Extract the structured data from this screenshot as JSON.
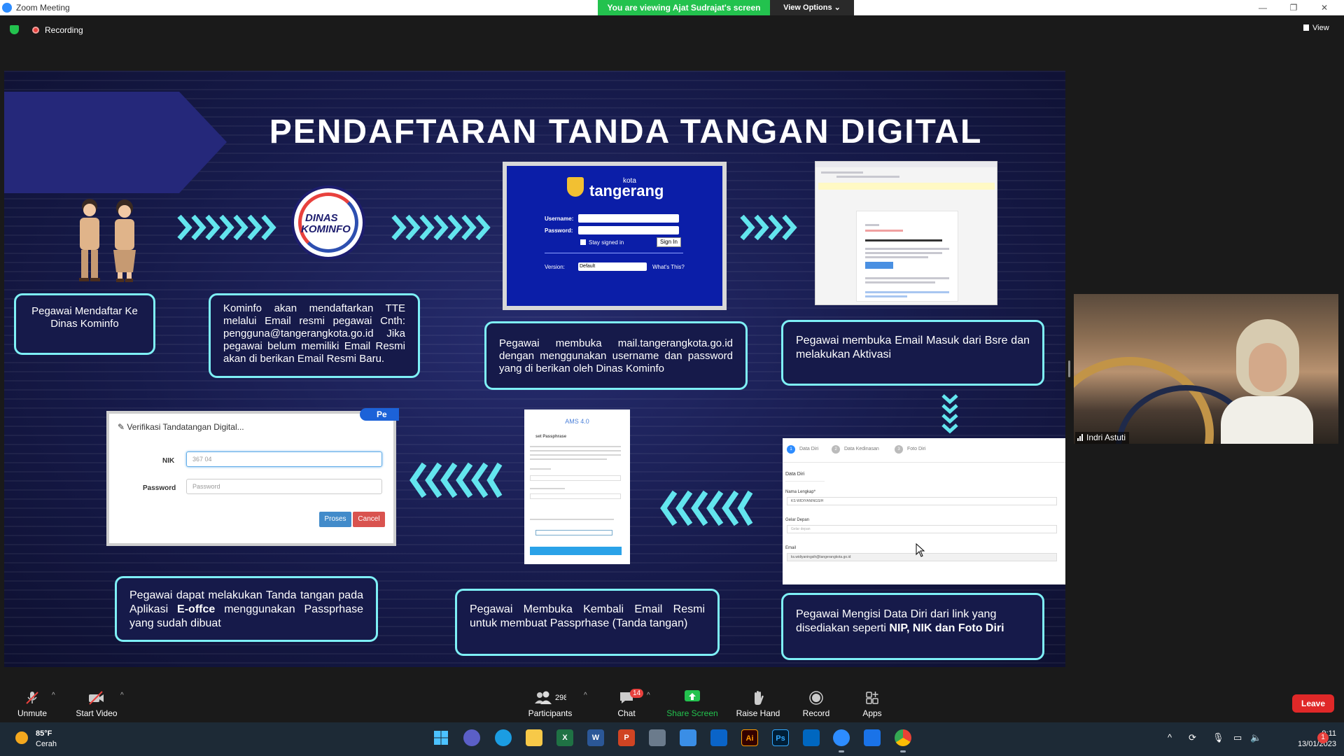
{
  "window": {
    "title": "Zoom Meeting",
    "viewing_banner": "You are viewing Ajat Sudrajat's screen",
    "view_options": "View Options",
    "minimize": "—",
    "maximize": "❐",
    "close": "✕"
  },
  "topbar": {
    "recording": "Recording",
    "view": "View"
  },
  "slide": {
    "title": "PENDAFTARAN TANDA TANGAN DIGITAL",
    "kominfo_logo_line1": "DINAS",
    "kominfo_logo_line2": "KOMINFO",
    "steps": [
      "Pegawai Mendaftar Ke Dinas Kominfo",
      "Kominfo akan mendaftarkan TTE melalui Email resmi pegawai Cnth: pengguna@tangerangkota.go.id Jika pegawai belum memiliki Email Resmi akan di berikan Email Resmi Baru.",
      "Pegawai membuka mail.tangerangkota.go.id dengan menggunakan username dan password yang di berikan oleh Dinas Kominfo",
      "Pegawai membuka Email Masuk dari Bsre dan melakukan Aktivasi",
      "Pegawai Mengisi Data Diri dari link yang disediakan seperti",
      "NIP, NIK dan Foto Diri",
      "Pegawai Membuka Kembali Email Resmi untuk membuat Passprhase (Tanda tangan)",
      "Pegawai dapat melakukan Tanda tangan pada Aplikasi",
      "E-offce",
      "menggunakan Passprhase yang sudah dibuat"
    ],
    "login": {
      "brand_small": "kota",
      "brand": "tangerang",
      "username_label": "Username:",
      "password_label": "Password:",
      "stay_signed": "Stay signed in",
      "sign_in": "Sign In",
      "version_label": "Version:",
      "version_value": "Default",
      "whats_this": "What's This?"
    },
    "verification": {
      "title": "Verifikasi Tandatangan Digital...",
      "nik_label": "NIK",
      "nik_value": "367              04",
      "password_label": "Password",
      "password_placeholder": "Password",
      "proses": "Proses",
      "cancel": "Cancel",
      "tab_label": "Pe"
    },
    "passphrase": {
      "title": "AMS 4.0",
      "subtitle": "set Passphrase"
    },
    "data_diri": {
      "step1": "Data Diri",
      "step2": "Data Kedinasan",
      "step3": "Foto Diri",
      "section": "Data Diri",
      "name_label": "Nama Lengkap*",
      "name_value": "KS WIDIYANINGSIH",
      "gelar_label": "Gelar Depan",
      "gelar_placeholder": "Gelar depan",
      "email_label": "Email",
      "email_value": "ks.widiyaningsih@tangerangkota.go.id"
    }
  },
  "participant": {
    "name": "Indri Astuti"
  },
  "toolbar": {
    "unmute": "Unmute",
    "start_video": "Start Video",
    "participants_count": "298",
    "participants": "Participants",
    "chat_badge": "14",
    "chat": "Chat",
    "share_screen": "Share Screen",
    "raise_hand": "Raise Hand",
    "record": "Record",
    "apps": "Apps",
    "leave": "Leave"
  },
  "taskbar": {
    "temp": "85°F",
    "weather": "Cerah",
    "time": "9:11",
    "date": "13/01/2023",
    "notifications": "1",
    "apps": [
      "windows",
      "meet",
      "edge",
      "explorer",
      "X",
      "W",
      "P",
      "calculator",
      "notepad",
      "mail",
      "Ai",
      "Ps",
      "store",
      "zoom",
      "store2",
      "chrome"
    ]
  },
  "colors": {
    "slide_bg": "#14163f",
    "accent_cyan": "#7ef0f6",
    "share_green": "#23c24e",
    "leave_red": "#e02828"
  }
}
